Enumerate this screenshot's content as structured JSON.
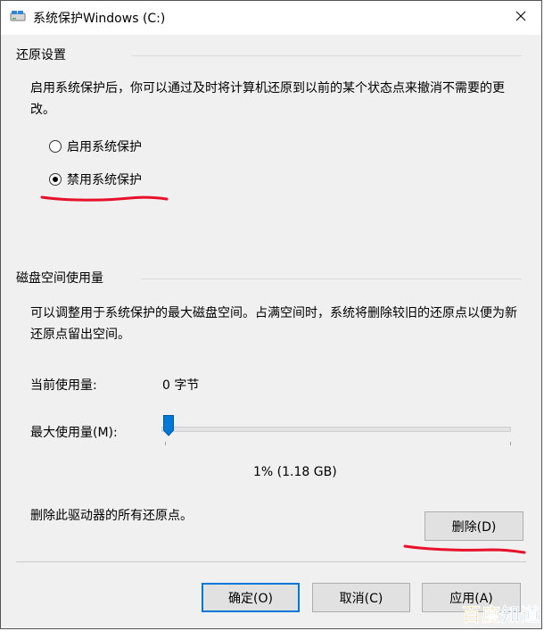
{
  "window": {
    "title": "系统保护Windows (C:)",
    "close_glyph": "✕"
  },
  "restore_settings": {
    "header": "还原设置",
    "description": "启用系统保护后，你可以通过及时将计算机还原到以前的某个状态点来撤消不需要的更改。",
    "options": [
      {
        "label": "启用系统保护",
        "checked": false
      },
      {
        "label": "禁用系统保护",
        "checked": true
      }
    ]
  },
  "disk_usage": {
    "header": "磁盘空间使用量",
    "description": "可以调整用于系统保护的最大磁盘空间。占满空间时，系统将删除较旧的还原点以便为新还原点留出空间。",
    "current_label": "当前使用量:",
    "current_value": "0 字节",
    "max_label": "最大使用量(M):",
    "max_value_text": "1% (1.18 GB)",
    "slider_percent": 1,
    "delete_description": "删除此驱动器的所有还原点。",
    "delete_button": "删除(D)"
  },
  "footer": {
    "ok_button": "确定(O)",
    "cancel_button": "取消(C)",
    "apply_button": "应用(A)"
  },
  "watermark": {
    "text": "百度知道",
    "colors": [
      "#e8a400",
      "#3d8ed6"
    ]
  },
  "colors": {
    "accent": "#0078d7",
    "annotation_red": "#e8102a",
    "slider_thumb": "#0078d7"
  },
  "icons": {
    "app": "drive-icon",
    "close": "close-icon",
    "slider": "slider-thumb-icon"
  }
}
